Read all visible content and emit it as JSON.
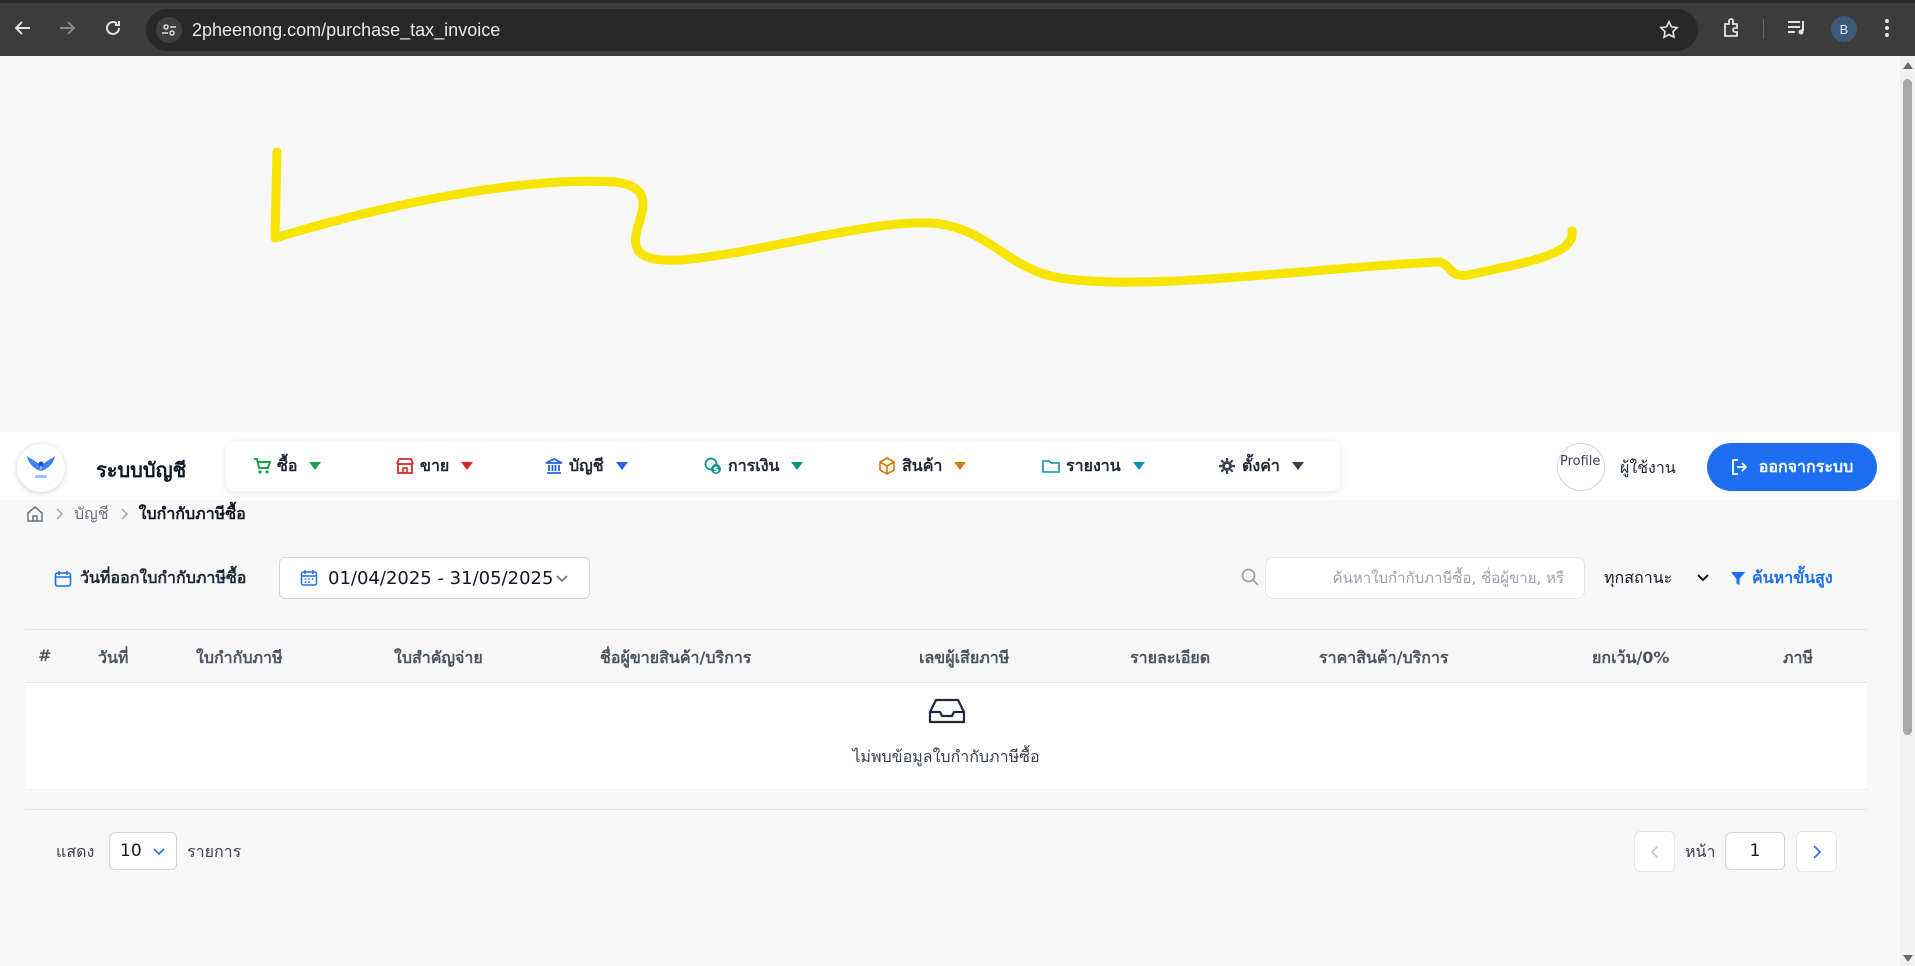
{
  "browser": {
    "url": "2pheenong.com/purchase_tax_invoice",
    "profile_initial": "B"
  },
  "app": {
    "brand": "ระบบบัญชี",
    "menu": [
      {
        "label": "ซื้อ",
        "icon": "cart-icon",
        "color": "#16a34a"
      },
      {
        "label": "ขาย",
        "icon": "store-icon",
        "color": "#dc2626"
      },
      {
        "label": "บัญชี",
        "icon": "bank-icon",
        "color": "#2563eb"
      },
      {
        "label": "การเงิน",
        "icon": "money-icon",
        "color": "#0d9488"
      },
      {
        "label": "สินค้า",
        "icon": "box-icon",
        "color": "#d97706"
      },
      {
        "label": "รายงาน",
        "icon": "folder-icon",
        "color": "#0891b2"
      },
      {
        "label": "ตั้งค่า",
        "icon": "gear-icon",
        "color": "#374151"
      }
    ],
    "profile_alt": "Profile",
    "username": "ผู้ใช้งาน",
    "logout_label": "ออกจากระบบ"
  },
  "breadcrumb": {
    "items": [
      "บัญชี",
      "ใบกำกับภาษีซื้อ"
    ]
  },
  "filters": {
    "date_label": "วันที่ออกใบกำกับภาษีซื้อ",
    "date_range": "01/04/2025 - 31/05/2025",
    "search_placeholder": "ค้นหาใบกำกับภาษีซื้อ, ชื่อผู้ขาย, หรื",
    "status_value": "ทุกสถานะ",
    "advanced_label": "ค้นหาขั้นสูง"
  },
  "table": {
    "columns": [
      "#",
      "วันที่",
      "ใบกำกับภาษี",
      "ใบสำคัญจ่าย",
      "ชื่อผู้ขายสินค้า/บริการ",
      "เลขผู้เสียภาษี",
      "รายละเอียด",
      "ราคาสินค้า/บริการ",
      "ยกเว้น/0%",
      "ภาษี"
    ],
    "rows": [],
    "empty_text": "ไม่พบข้อมูลใบกำกับภาษีซื้อ"
  },
  "pagination": {
    "show_label": "แสดง",
    "page_size": "10",
    "items_label": "รายการ",
    "page_label": "หน้า",
    "current_page": "1"
  },
  "colors": {
    "accent": "#1d6ef0",
    "annotation": "#f7e400"
  }
}
